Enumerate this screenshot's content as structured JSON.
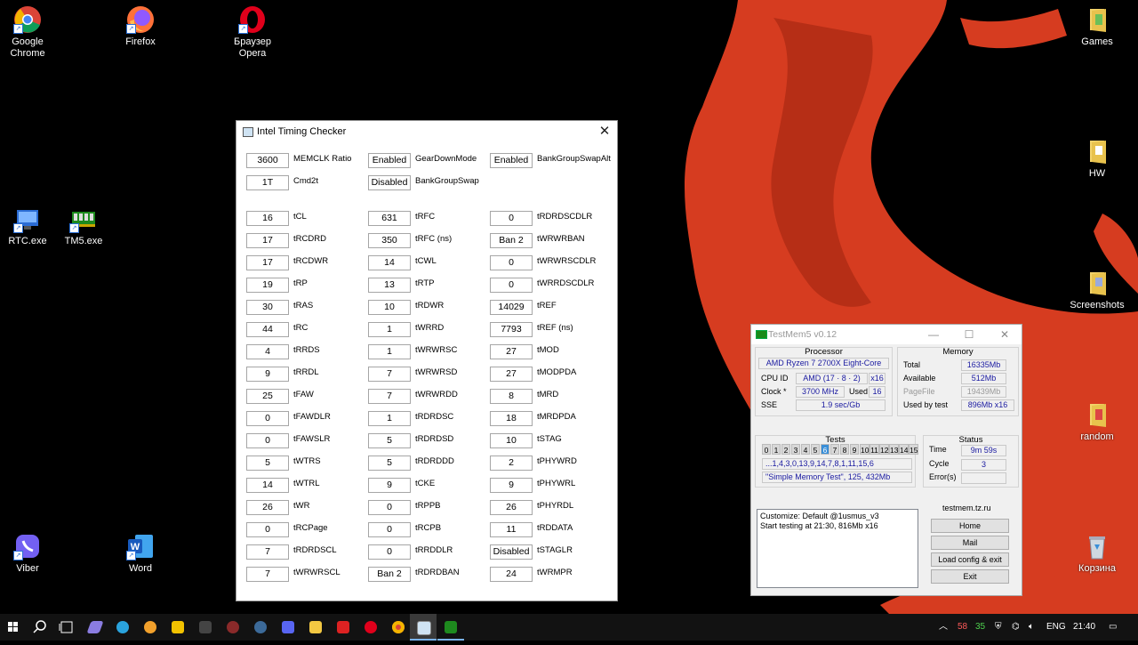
{
  "desktop": {
    "icons": [
      {
        "label": "Google\nChrome",
        "icon": "chrome-icon"
      },
      {
        "label": "Firefox",
        "icon": "firefox-icon"
      },
      {
        "label": "Браузер\nOpera",
        "icon": "opera-icon"
      },
      {
        "label": "Games",
        "icon": "folder-icon"
      },
      {
        "label": "HW",
        "icon": "folder-icon"
      },
      {
        "label": "RTC.exe",
        "icon": "rtc-icon"
      },
      {
        "label": "TM5.exe",
        "icon": "ram-icon"
      },
      {
        "label": "Screenshots",
        "icon": "folder-icon"
      },
      {
        "label": "random",
        "icon": "folder-icon"
      },
      {
        "label": "Viber",
        "icon": "viber-icon"
      },
      {
        "label": "Word",
        "icon": "word-icon"
      },
      {
        "label": "Корзина",
        "icon": "recycle-bin-icon"
      }
    ]
  },
  "itc": {
    "title": "Intel Timing Checker",
    "top": [
      {
        "value": "3600",
        "label": "MEMCLK Ratio"
      },
      {
        "value": "1T",
        "label": "Cmd2t"
      },
      {
        "value": "Enabled",
        "label": "GearDownMode"
      },
      {
        "value": "Disabled",
        "label": "BankGroupSwap"
      },
      {
        "value": "Enabled",
        "label": "BankGroupSwapAlt"
      }
    ],
    "col1": [
      {
        "value": "16",
        "label": "tCL"
      },
      {
        "value": "17",
        "label": "tRCDRD"
      },
      {
        "value": "17",
        "label": "tRCDWR"
      },
      {
        "value": "19",
        "label": "tRP"
      },
      {
        "value": "30",
        "label": "tRAS"
      },
      {
        "value": "44",
        "label": "tRC"
      },
      {
        "value": "4",
        "label": "tRRDS"
      },
      {
        "value": "9",
        "label": "tRRDL"
      },
      {
        "value": "25",
        "label": "tFAW"
      },
      {
        "value": "0",
        "label": "tFAWDLR"
      },
      {
        "value": "0",
        "label": "tFAWSLR"
      },
      {
        "value": "5",
        "label": "tWTRS"
      },
      {
        "value": "14",
        "label": "tWTRL"
      },
      {
        "value": "26",
        "label": "tWR"
      },
      {
        "value": "0",
        "label": "tRCPage"
      },
      {
        "value": "7",
        "label": "tRDRDSCL"
      },
      {
        "value": "7",
        "label": "tWRWRSCL"
      }
    ],
    "col2": [
      {
        "value": "631",
        "label": "tRFC"
      },
      {
        "value": "350",
        "label": "tRFC (ns)"
      },
      {
        "value": "14",
        "label": "tCWL"
      },
      {
        "value": "13",
        "label": "tRTP"
      },
      {
        "value": "10",
        "label": "tRDWR"
      },
      {
        "value": "1",
        "label": "tWRRD"
      },
      {
        "value": "1",
        "label": "tWRWRSC"
      },
      {
        "value": "7",
        "label": "tWRWRSD"
      },
      {
        "value": "7",
        "label": "tWRWRDD"
      },
      {
        "value": "1",
        "label": "tRDRDSC"
      },
      {
        "value": "5",
        "label": "tRDRDSD"
      },
      {
        "value": "5",
        "label": "tRDRDDD"
      },
      {
        "value": "9",
        "label": "tCKE"
      },
      {
        "value": "0",
        "label": "tRPPB"
      },
      {
        "value": "0",
        "label": "tRCPB"
      },
      {
        "value": "0",
        "label": "tRRDDLR"
      },
      {
        "value": "Ban 2",
        "label": "tRDRDBAN"
      }
    ],
    "col3": [
      {
        "value": "0",
        "label": "tRDRDSCDLR"
      },
      {
        "value": "Ban 2",
        "label": "tWRWRBAN"
      },
      {
        "value": "0",
        "label": "tWRWRSCDLR"
      },
      {
        "value": "0",
        "label": "tWRRDSCDLR"
      },
      {
        "value": "14029",
        "label": "tREF"
      },
      {
        "value": "7793",
        "label": "tREF (ns)"
      },
      {
        "value": "27",
        "label": "tMOD"
      },
      {
        "value": "27",
        "label": "tMODPDA"
      },
      {
        "value": "8",
        "label": "tMRD"
      },
      {
        "value": "18",
        "label": "tMRDPDA"
      },
      {
        "value": "10",
        "label": "tSTAG"
      },
      {
        "value": "2",
        "label": "tPHYWRD"
      },
      {
        "value": "9",
        "label": "tPHYWRL"
      },
      {
        "value": "26",
        "label": "tPHYRDL"
      },
      {
        "value": "11",
        "label": "tRDDATA"
      },
      {
        "value": "Disabled",
        "label": "tSTAGLR"
      },
      {
        "value": "24",
        "label": "tWRMPR"
      }
    ]
  },
  "tm5": {
    "title": "TestMem5 v0.12",
    "processor": {
      "heading": "Processor",
      "name": "AMD Ryzen 7 2700X Eight-Core",
      "cpuid_label": "CPU ID",
      "cpuid": "AMD  (17 · 8 · 2)",
      "cpuid_x": "x16",
      "clock_label": "Clock *",
      "clock": "3700 MHz",
      "used_label": "Used",
      "used": "16",
      "sse_label": "SSE",
      "sse": "1.9 sec/Gb"
    },
    "memory": {
      "heading": "Memory",
      "total_label": "Total",
      "total": "16335Mb",
      "available_label": "Available",
      "available": "512Mb",
      "pagefile_label": "PageFile",
      "pagefile": "19439Mb",
      "usedbytest_label": "Used by test",
      "usedbytest": "896Mb x16"
    },
    "tests": {
      "heading": "Tests",
      "cells": [
        "0",
        "1",
        "2",
        "3",
        "4",
        "5",
        "6",
        "7",
        "8",
        "9",
        "10",
        "11",
        "12",
        "13",
        "14",
        "15"
      ],
      "active": "6",
      "sequence": "...1,4,3,0,13,9,14,7,8,1,11,15,6",
      "current": "\"Simple Memory Test\", 125, 432Mb"
    },
    "status": {
      "heading": "Status",
      "time_label": "Time",
      "time": "9m 59s",
      "cycle_label": "Cycle",
      "cycle": "3",
      "errors_label": "Error(s)",
      "errors": ""
    },
    "log": [
      "Customize: Default @1usmus_v3",
      "Start testing at 21:30, 816Mb x16"
    ],
    "site": "testmem.tz.ru",
    "buttons": {
      "home": "Home",
      "mail": "Mail",
      "load": "Load config & exit",
      "exit": "Exit"
    }
  },
  "taskbar": {
    "temp1": "58",
    "temp2": "35",
    "lang": "ENG",
    "time": "21:40"
  }
}
